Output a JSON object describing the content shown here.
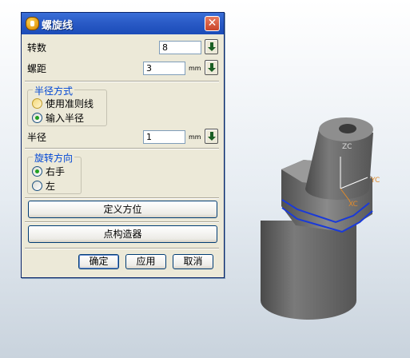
{
  "dialog": {
    "title": "螺旋线",
    "close": "✕",
    "turns": {
      "label": "转数",
      "value": "8"
    },
    "pitch": {
      "label": "螺距",
      "value": "3",
      "unit": "mm"
    },
    "radius_method": {
      "title": "半径方式",
      "options": [
        "使用准则线",
        "输入半径"
      ],
      "selected": "输入半径"
    },
    "radius": {
      "label": "半径",
      "value": "1",
      "unit": "mm"
    },
    "rotation": {
      "title": "旋转方向",
      "options": [
        "右手",
        "左"
      ],
      "selected": "右手"
    },
    "define_orientation": "定义方位",
    "point_constructor": "点构造器",
    "buttons": {
      "ok": "确定",
      "apply": "应用",
      "cancel": "取消"
    }
  },
  "viewport": {
    "axes": {
      "zc": "ZC",
      "yc": "YC",
      "xc": "XC"
    },
    "colors": {
      "axis_yc": "#e08a2a",
      "helix": "#1a3ad8",
      "body": "#6e6e6e"
    }
  }
}
